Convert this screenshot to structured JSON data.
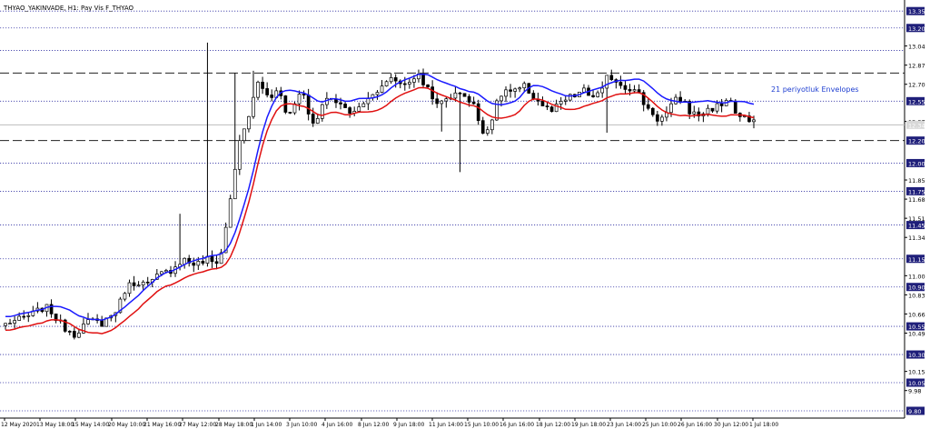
{
  "chart_data": {
    "type": "candlestick",
    "title": "THYAO_YAKINVADE, H1:  Pay Vis F_THYAO",
    "annotation": "21 periyotluk Envelopes",
    "ylim": [
      9.8,
      13.4
    ],
    "y_tick_labels": [
      "13.35",
      "13.20",
      "13.04",
      "12.87",
      "12.70",
      "12.55",
      "12.37",
      "12.20",
      "12.03",
      "11.85",
      "11.68",
      "11.51",
      "11.34",
      "11.15",
      "11.00",
      "10.83",
      "10.66",
      "10.49",
      "10.30",
      "10.15",
      "9.98",
      "9.80"
    ],
    "y_highlight_labels": [
      "13.35",
      "13.20",
      "13.00",
      "12.80",
      "12.55",
      "12.20",
      "12.00",
      "11.75",
      "11.45",
      "11.15",
      "10.90",
      "10.55",
      "10.30",
      "10.05",
      "9.80"
    ],
    "y_price_labels": [
      {
        "label": "13.35",
        "value": 13.35
      },
      {
        "label": "13.20",
        "value": 13.2
      },
      {
        "label": "13.04",
        "value": 13.04
      },
      {
        "label": "12.87",
        "value": 12.87
      },
      {
        "label": "12.70",
        "value": 12.7
      },
      {
        "label": "12.55",
        "value": 12.55
      },
      {
        "label": "12.37",
        "value": 12.37
      },
      {
        "label": "12.20",
        "value": 12.2
      },
      {
        "label": "12.00",
        "value": 12.0
      },
      {
        "label": "11.85",
        "value": 11.85
      },
      {
        "label": "11.75",
        "value": 11.75
      },
      {
        "label": "11.68",
        "value": 11.68
      },
      {
        "label": "11.51",
        "value": 11.51
      },
      {
        "label": "11.45",
        "value": 11.45
      },
      {
        "label": "11.34",
        "value": 11.34
      },
      {
        "label": "11.15",
        "value": 11.15
      },
      {
        "label": "11.00",
        "value": 11.0
      },
      {
        "label": "10.90",
        "value": 10.9
      },
      {
        "label": "10.83",
        "value": 10.83
      },
      {
        "label": "10.66",
        "value": 10.66
      },
      {
        "label": "10.55",
        "value": 10.55
      },
      {
        "label": "10.49",
        "value": 10.49
      },
      {
        "label": "10.30",
        "value": 10.3
      },
      {
        "label": "10.15",
        "value": 10.15
      },
      {
        "label": "10.05",
        "value": 10.05
      },
      {
        "label": "9.98",
        "value": 9.98
      },
      {
        "label": "9.80",
        "value": 9.8
      }
    ],
    "boxed_labels": [
      "13.35",
      "13.20",
      "13.00",
      "12.80",
      "12.55",
      "12.20",
      "12.00",
      "11.75",
      "11.45",
      "11.15",
      "10.90",
      "10.55",
      "10.30",
      "10.05",
      "9.80"
    ],
    "horizontal_levels_dotted": [
      13.35,
      13.2,
      13.0,
      12.55,
      12.0,
      11.75,
      11.45,
      11.15,
      10.9,
      10.55,
      10.3,
      10.05,
      9.8
    ],
    "horizontal_levels_dashed": [
      12.8,
      12.2
    ],
    "current_price": 12.34,
    "x_tick_labels": [
      "12 May 2020",
      "13 May 18:00",
      "15 May 14:00",
      "20 May 10:00",
      "21 May 16:00",
      "27 May 12:00",
      "28 May 18:00",
      "1 Jun 14:00",
      "3 Jun 10:00",
      "4 Jun 16:00",
      "8 Jun 12:00",
      "9 Jun 18:00",
      "11 Jun 14:00",
      "15 Jun 10:00",
      "16 Jun 16:00",
      "18 Jun 12:00",
      "19 Jun 18:00",
      "23 Jun 14:00",
      "25 Jun 10:00",
      "26 Jun 16:00",
      "30 Jun 12:00",
      "1 Jul 18:00"
    ],
    "price_path": [
      10.57,
      10.6,
      10.6,
      10.63,
      10.65,
      10.68,
      10.72,
      10.7,
      10.62,
      10.55,
      10.52,
      10.48,
      10.55,
      10.58,
      10.6,
      10.57,
      10.62,
      10.66,
      10.75,
      10.9,
      10.93,
      10.95,
      10.92,
      10.93,
      11.0,
      11.02,
      11.05,
      11.1,
      11.15,
      11.12,
      11.1,
      11.12,
      11.15,
      11.1,
      11.2,
      11.5,
      11.9,
      12.2,
      12.35,
      12.55,
      12.75,
      12.6,
      12.6,
      12.7,
      12.45,
      12.45,
      12.6,
      12.65,
      12.35,
      12.4,
      12.5,
      12.6,
      12.5,
      12.55,
      12.45,
      12.45,
      12.5,
      12.6,
      12.6,
      12.7,
      12.7,
      12.75,
      12.72,
      12.7,
      12.75,
      12.78,
      12.7,
      12.65,
      12.5,
      12.55,
      12.6,
      12.6,
      12.65,
      12.55,
      12.5,
      12.3,
      12.3,
      12.45,
      12.6,
      12.65,
      12.62,
      12.65,
      12.68,
      12.6,
      12.55,
      12.5,
      12.45,
      12.5,
      12.55,
      12.58,
      12.6,
      12.65,
      12.6,
      12.6,
      12.62,
      12.78,
      12.75,
      12.7,
      12.68,
      12.65,
      12.6,
      12.5,
      12.45,
      12.38,
      12.42,
      12.5,
      12.58,
      12.55,
      12.45,
      12.42,
      12.45,
      12.48,
      12.5,
      12.52,
      12.6,
      12.45,
      12.4,
      12.38,
      12.35
    ]
  }
}
